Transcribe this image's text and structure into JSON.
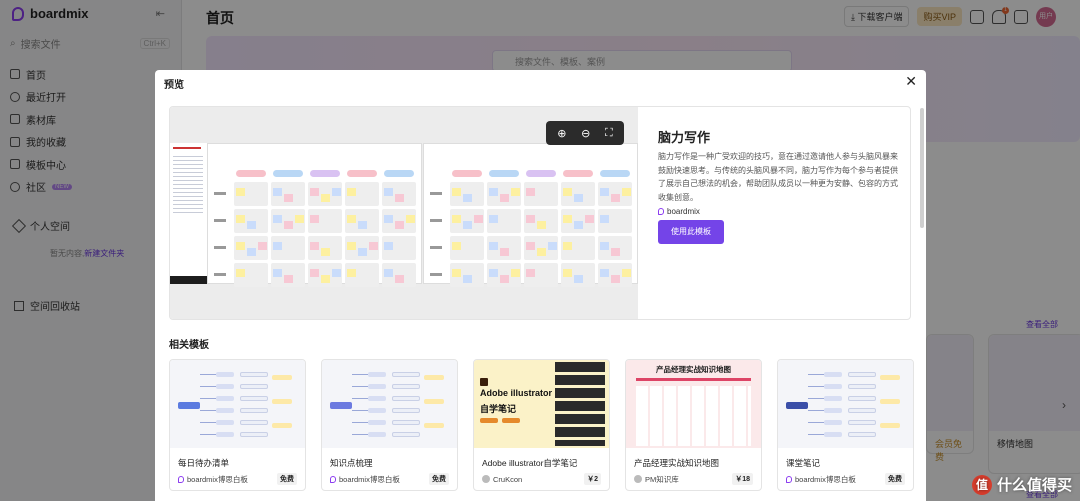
{
  "app": {
    "brand": "boardmix",
    "search_placeholder": "搜索文件",
    "search_shortcut": "Ctrl+K",
    "nav": [
      {
        "label": "首页",
        "icon": "home-icon"
      },
      {
        "label": "最近打开",
        "icon": "clock-icon"
      },
      {
        "label": "素材库",
        "icon": "folder-icon"
      },
      {
        "label": "我的收藏",
        "icon": "star-icon"
      },
      {
        "label": "模板中心",
        "icon": "template-icon"
      },
      {
        "label": "社区",
        "icon": "community-icon",
        "badge": "NEW"
      }
    ],
    "personal_space": "个人空间",
    "empty_text": "暂无内容,",
    "new_folder": "新建文件夹",
    "trash": "空间回收站",
    "page_title": "首页",
    "download_label": "下载客户端",
    "vip_label": "购买VIP",
    "avatar_text": "用户",
    "notification_count": "1",
    "hero_search_placeholder": "搜索文件、模板、案例",
    "see_all": "查看全部",
    "bg_card_label": "移情地图",
    "bg_card_tag": "会员免费"
  },
  "modal": {
    "title": "预览",
    "template_title": "脑力写作",
    "template_desc": "脑力写作是一种广受欢迎的技巧，意在通过邀请他人参与头脑风暴来鼓励快速思考。与传统的头脑风暴不同，脑力写作为每个参与者提供了展示自己想法的机会，帮助团队成员以一种更为安静、包容的方式收集创意。",
    "brand": "boardmix",
    "use_button": "使用此模板",
    "related_title": "相关模板",
    "cards": [
      {
        "name": "每日待办清单",
        "author": "boardmix博思白板",
        "price": "免费"
      },
      {
        "name": "知识点梳理",
        "author": "boardmix博思白板",
        "price": "免费"
      },
      {
        "name": "Adobe illustrator自学笔记",
        "author": "CruKcon",
        "price": "￥2"
      },
      {
        "name": "产品经理实战知识地图",
        "author": "PM知识库",
        "price": "￥18"
      },
      {
        "name": "课堂笔记",
        "author": "boardmix博思白板",
        "price": "免费"
      }
    ],
    "card3_cover": [
      "Adobe illustrator",
      "自学笔记"
    ],
    "card4_cover": "产品经理实战知识地图"
  },
  "watermark": "什么值得买",
  "watermark_badge": "值"
}
